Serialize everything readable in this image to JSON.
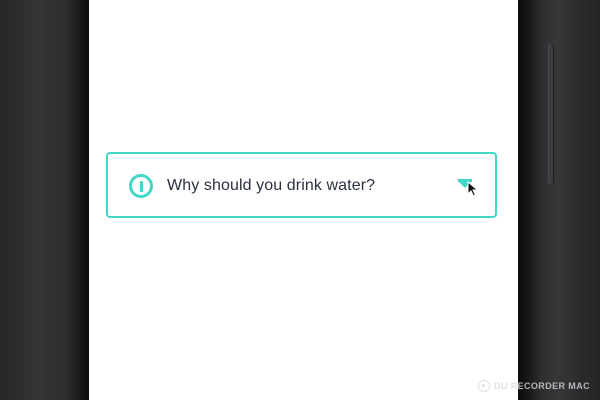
{
  "card": {
    "question": "Why should you drink water?",
    "icon": "info-icon",
    "expand_icon": "chevron-down-icon"
  },
  "colors": {
    "accent": "#41d8c7",
    "text": "#2a3040",
    "screen_background": "#ffffff",
    "device_frame": "#2b2c2e"
  },
  "watermark": {
    "text": "DU RECORDER MAC"
  }
}
